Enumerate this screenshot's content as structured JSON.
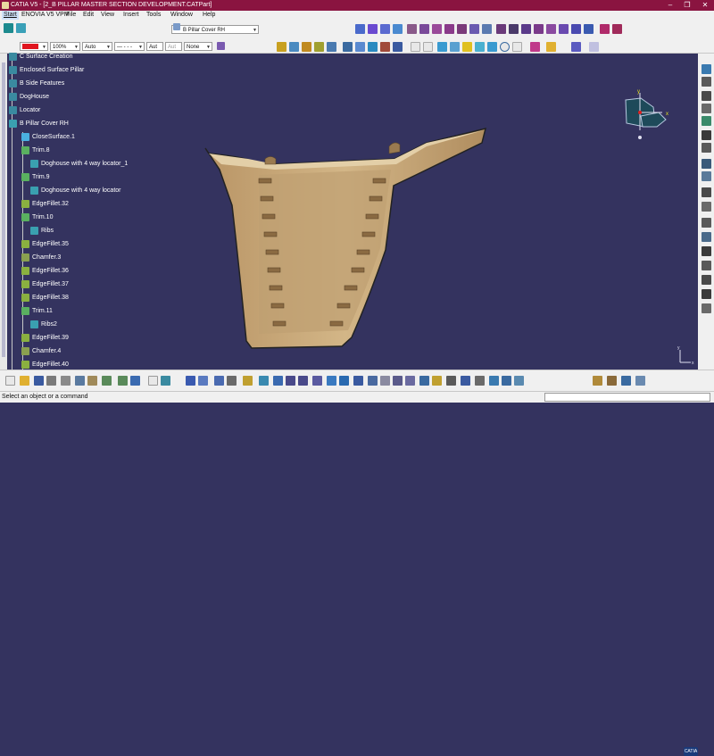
{
  "window": {
    "app": "CATIA V5",
    "title": "CATIA V5 - [2_B PILLAR MASTER SECTION DEVELOPMENT.CATPart]",
    "minimize": "–",
    "restore": "❐",
    "close": "✕"
  },
  "menubar": {
    "items": [
      "Start",
      "ENOVIA V5 VPM",
      "File",
      "Edit",
      "View",
      "Insert",
      "Tools",
      "Window",
      "Help"
    ]
  },
  "property_toolbar": {
    "color_swatch": "#e0141e",
    "transparency": "100%",
    "line_type": "Auto",
    "line_style": "— - - -",
    "line_weight_1": "Aut",
    "line_weight_2": "Aut",
    "layer": "None",
    "current_body": "B Pillar Cover RH"
  },
  "tree": {
    "nodes": [
      {
        "label": "C Surface Creation",
        "icon": "geometric-set-icon"
      },
      {
        "label": "Enclosed Surface Pillar",
        "icon": "geometric-set-icon"
      },
      {
        "label": "B Side Features",
        "icon": "geometric-set-icon"
      },
      {
        "label": "DogHouse",
        "icon": "geometric-set-icon"
      },
      {
        "label": "Locator",
        "icon": "geometric-set-icon"
      },
      {
        "label": "B Pillar Cover RH",
        "icon": "body-icon"
      },
      {
        "label": "CloseSurface.1",
        "icon": "close-surface-icon"
      },
      {
        "label": "Trim.8",
        "icon": "trim-icon"
      },
      {
        "label": "Doghouse with 4 way locator_1",
        "icon": "body-icon"
      },
      {
        "label": "Trim.9",
        "icon": "trim-icon"
      },
      {
        "label": "Doghouse with 4 way locator",
        "icon": "body-icon"
      },
      {
        "label": "EdgeFillet.32",
        "icon": "fillet-icon"
      },
      {
        "label": "Trim.10",
        "icon": "trim-icon"
      },
      {
        "label": "Ribs",
        "icon": "body-icon"
      },
      {
        "label": "EdgeFillet.35",
        "icon": "fillet-icon"
      },
      {
        "label": "Chamfer.3",
        "icon": "chamfer-icon"
      },
      {
        "label": "EdgeFillet.36",
        "icon": "fillet-icon"
      },
      {
        "label": "EdgeFillet.37",
        "icon": "fillet-icon"
      },
      {
        "label": "EdgeFillet.38",
        "icon": "fillet-icon"
      },
      {
        "label": "Trim.11",
        "icon": "trim-icon"
      },
      {
        "label": "Ribs2",
        "icon": "body-icon"
      },
      {
        "label": "EdgeFillet.39",
        "icon": "fillet-icon"
      },
      {
        "label": "Chamfer.4",
        "icon": "chamfer-icon"
      },
      {
        "label": "EdgeFillet.40",
        "icon": "fillet-icon"
      }
    ]
  },
  "compass": {
    "x_label": "x",
    "y_label": "y"
  },
  "axis_triad": {
    "x_label": "x",
    "y_label": "y"
  },
  "status_bar": {
    "message": "Select an object or a command"
  },
  "brand": {
    "logo_text": "CATIA"
  },
  "colors": {
    "viewport_bg": "#34335f",
    "part_color": "#c9a97a",
    "title_bar": "#8a1440",
    "tree_text": "#ffffff"
  }
}
